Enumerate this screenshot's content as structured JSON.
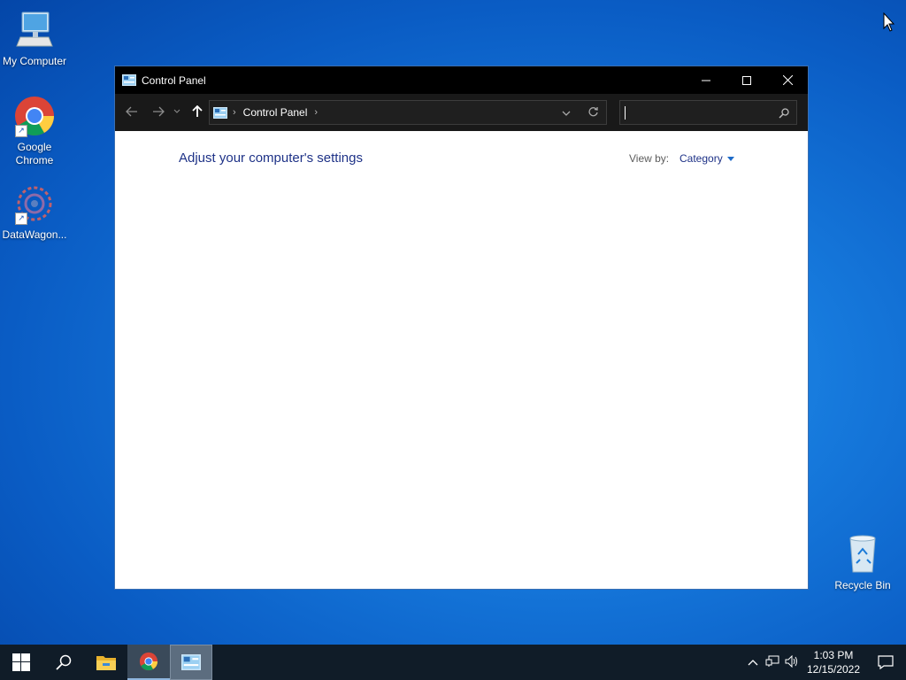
{
  "desktop": {
    "icons": [
      {
        "label": "My Computer"
      },
      {
        "label": "Google Chrome"
      },
      {
        "label": "DataWagon..."
      },
      {
        "label": "Recycle Bin"
      }
    ]
  },
  "window": {
    "title": "Control Panel",
    "address": {
      "segment": "Control Panel"
    },
    "search": {
      "value": "",
      "placeholder": ""
    },
    "heading": "Adjust your computer's settings",
    "view_by_label": "View by:",
    "view_by_value": "Category"
  },
  "taskbar": {
    "time": "1:03 PM",
    "date": "12/15/2022"
  },
  "colors": {
    "desktop_bg": "#1679dc",
    "titlebar_bg": "#000000",
    "toolbar_bg": "#191919",
    "link_text": "#1e3287",
    "taskbar_bg": "#101c28"
  }
}
